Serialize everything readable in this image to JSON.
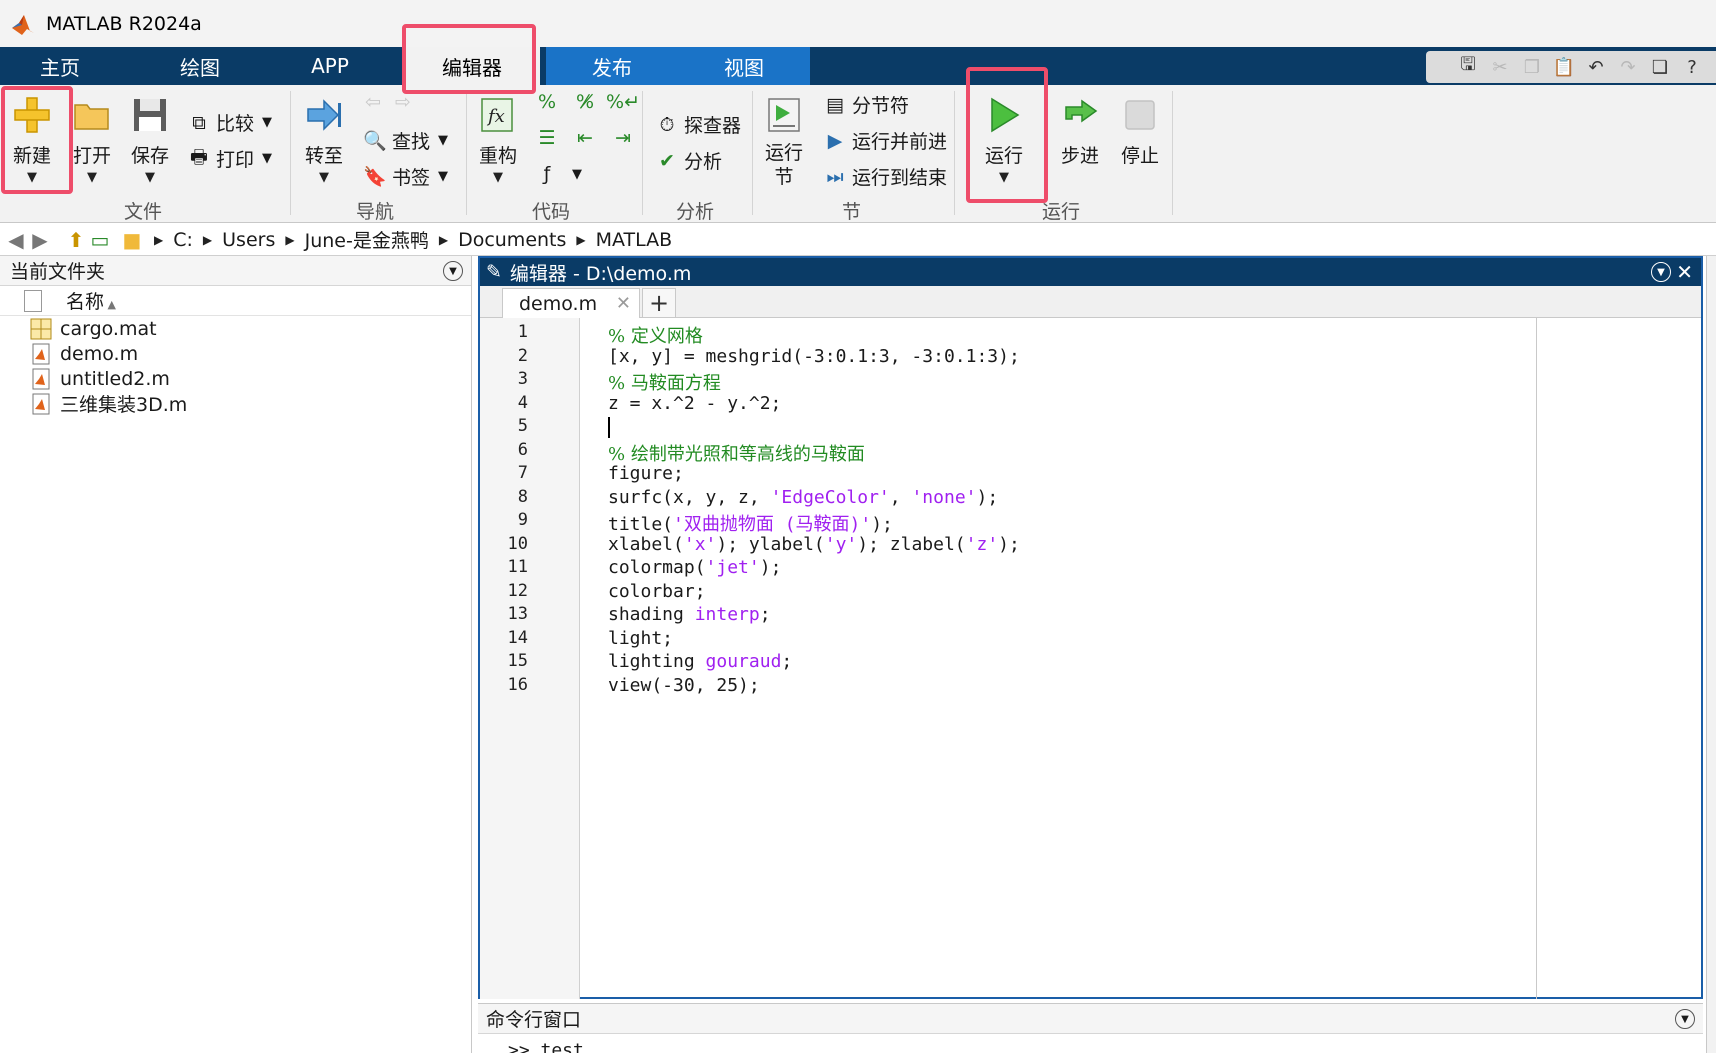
{
  "window": {
    "title": "MATLAB R2024a"
  },
  "tabs": [
    {
      "label": "主页"
    },
    {
      "label": "绘图"
    },
    {
      "label": "APP"
    },
    {
      "label": "编辑器"
    },
    {
      "label": "发布"
    },
    {
      "label": "视图"
    }
  ],
  "ribbon": {
    "file": {
      "group": "文件",
      "new": "新建",
      "open": "打开",
      "save": "保存",
      "compare": "比较",
      "print": "打印"
    },
    "navigate": {
      "group": "导航",
      "goto": "转至",
      "find": "查找",
      "bookmark": "书签"
    },
    "code": {
      "group": "代码",
      "refactor": "重构"
    },
    "analyze": {
      "group": "分析",
      "profiler": "探查器",
      "analyze": "分析"
    },
    "section": {
      "group": "节",
      "run_section": "运行节",
      "section_break": "分节符",
      "run_advance": "运行并前进",
      "run_to_end": "运行到结束"
    },
    "run": {
      "group": "运行",
      "run": "运行",
      "step": "步进",
      "stop": "停止"
    }
  },
  "address": {
    "segments": [
      "C:",
      "Users",
      "June-是金燕鸭",
      "Documents",
      "MATLAB"
    ]
  },
  "folder_panel": {
    "title": "当前文件夹",
    "column_name": "名称",
    "files": [
      {
        "name": "cargo.mat",
        "icon": "mat-file-icon"
      },
      {
        "name": "demo.m",
        "icon": "m-file-icon"
      },
      {
        "name": "untitled2.m",
        "icon": "m-file-icon"
      },
      {
        "name": "三维集装3D.m",
        "icon": "m-file-icon"
      }
    ]
  },
  "editor": {
    "title": "编辑器 - D:\\demo.m",
    "tab": "demo.m",
    "lines": [
      "% 定义网格",
      "[x, y] = meshgrid(-3:0.1:3, -3:0.1:3);",
      "% 马鞍面方程",
      "z = x.^2 - y.^2;",
      "",
      "% 绘制带光照和等高线的马鞍面",
      "figure;",
      "surfc(x, y, z, 'EdgeColor', 'none');",
      "title('双曲抛物面 (马鞍面)');",
      "xlabel('x'); ylabel('y'); zlabel('z');",
      "colormap('jet');",
      "colorbar;",
      "shading interp;",
      "light;",
      "lighting gouraud;",
      "view(-30, 25);"
    ]
  },
  "command_window": {
    "title": "命令行窗口",
    "prompt": ">> test"
  },
  "colors": {
    "ribbon_dark": "#0a3b66",
    "tab_blue": "#1a73c7",
    "highlight": "#ee4d6a",
    "comment": "#228b22",
    "string": "#a020f0"
  }
}
